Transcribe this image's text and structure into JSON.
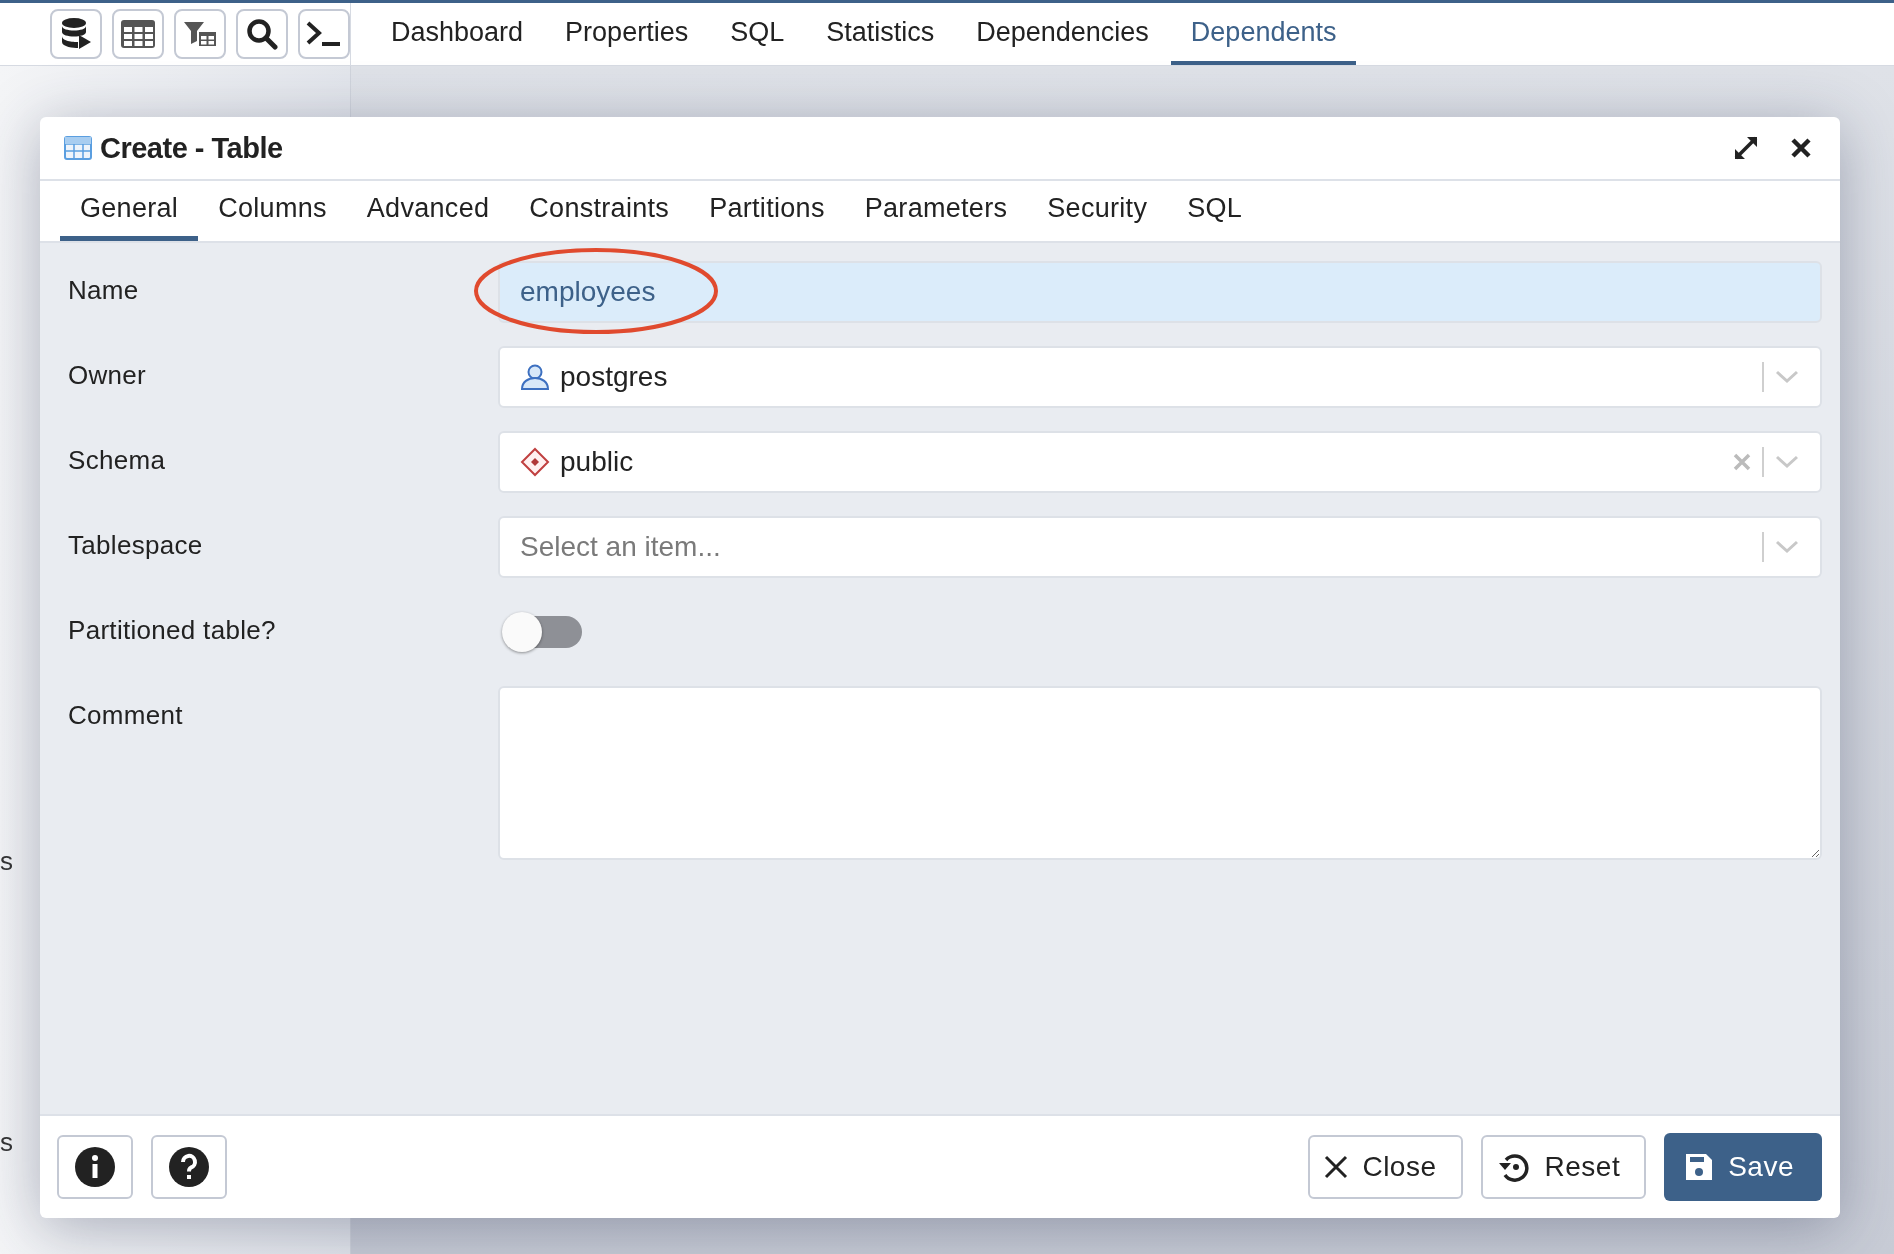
{
  "top_tabs": [
    {
      "label": "Dashboard",
      "selected": false
    },
    {
      "label": "Properties",
      "selected": false
    },
    {
      "label": "SQL",
      "selected": false
    },
    {
      "label": "Statistics",
      "selected": false
    },
    {
      "label": "Dependencies",
      "selected": false
    },
    {
      "label": "Dependents",
      "selected": true
    }
  ],
  "sidebar_fragments": [
    "s",
    "s"
  ],
  "dialog": {
    "title": "Create - Table",
    "tabs": [
      {
        "label": "General",
        "selected": true
      },
      {
        "label": "Columns",
        "selected": false
      },
      {
        "label": "Advanced",
        "selected": false
      },
      {
        "label": "Constraints",
        "selected": false
      },
      {
        "label": "Partitions",
        "selected": false
      },
      {
        "label": "Parameters",
        "selected": false
      },
      {
        "label": "Security",
        "selected": false
      },
      {
        "label": "SQL",
        "selected": false
      }
    ],
    "fields": [
      {
        "kind": "text",
        "label": "Name",
        "value": "employees",
        "focused": true,
        "circled": true
      },
      {
        "kind": "role-select",
        "label": "Owner",
        "value": "postgres",
        "clearable": false
      },
      {
        "kind": "schema-select",
        "label": "Schema",
        "value": "public",
        "clearable": true
      },
      {
        "kind": "select",
        "label": "Tablespace",
        "placeholder": "Select an item...",
        "clearable": false
      },
      {
        "kind": "switch",
        "label": "Partitioned table?",
        "on": false
      },
      {
        "kind": "textarea",
        "label": "Comment"
      }
    ],
    "buttons": [
      {
        "kind": "close",
        "label": "Close"
      },
      {
        "kind": "reset",
        "label": "Reset"
      },
      {
        "kind": "save",
        "label": "Save"
      }
    ]
  }
}
